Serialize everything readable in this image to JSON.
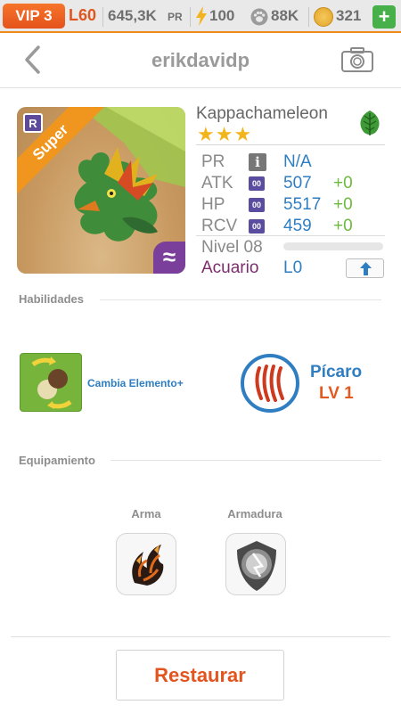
{
  "status_bar": {
    "vip": "VIP 3",
    "level": "L60",
    "pr_value": "645,3K",
    "pr_unit": "PR",
    "energy": "100",
    "food": "88K",
    "coins": "321",
    "add_button": "+",
    "accent_color": "#f08a1c"
  },
  "header": {
    "back_icon": "chevron-left-icon",
    "title": "erikdavidp",
    "camera_icon": "camera-icon"
  },
  "monster": {
    "name": "Kappachameleon",
    "stars": "★★★",
    "star_count": 3,
    "element_icon": "leaf-icon",
    "rank_badge": "R",
    "grade_ribbon": "Super",
    "corner_symbol": "≈",
    "stats": [
      {
        "label": "PR",
        "badge": "i",
        "value": "N/A",
        "bonus": ""
      },
      {
        "label": "ATK",
        "badge": "00",
        "value": "507",
        "bonus": "+0"
      },
      {
        "label": "HP",
        "badge": "00",
        "value": "5517",
        "bonus": "+0"
      },
      {
        "label": "RCV",
        "badge": "00",
        "value": "459",
        "bonus": "+0"
      }
    ],
    "nivel": "Nivel 08",
    "xp_progress": 0,
    "acuario_label": "Acuario",
    "acuario_level": "L0",
    "upgrade_icon": "arrow-up-icon"
  },
  "abilities": {
    "heading": "Habilidades",
    "ability_name": "Cambia Elemento+",
    "skill_name": "Pícaro",
    "skill_level": "LV 1"
  },
  "equipment": {
    "heading": "Equipamiento",
    "weapon_label": "Arma",
    "armor_label": "Armadura"
  },
  "footer": {
    "restore_label": "Restaurar"
  }
}
